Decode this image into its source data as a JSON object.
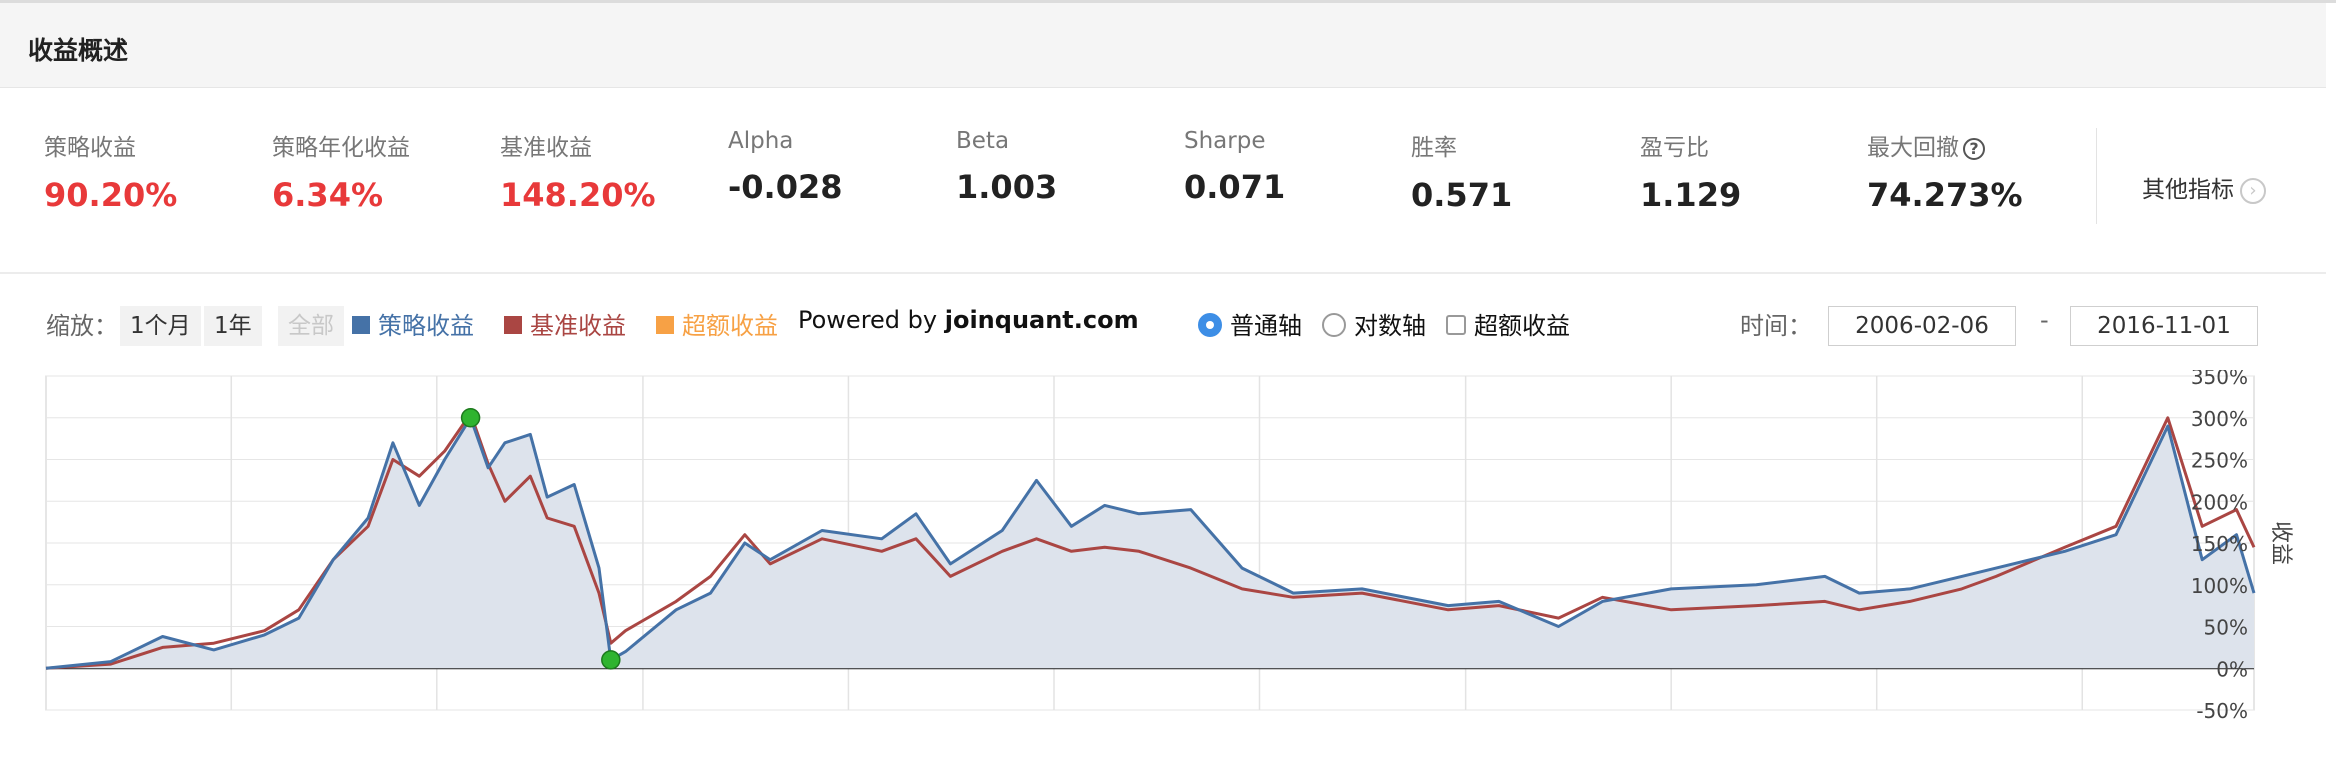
{
  "header": {
    "title": "收益概述"
  },
  "metrics": [
    {
      "label": "策略收益",
      "value": "90.20%",
      "color": "#e8393a"
    },
    {
      "label": "策略年化收益",
      "value": "6.34%",
      "color": "#e8393a"
    },
    {
      "label": "基准收益",
      "value": "148.20%",
      "color": "#e8393a"
    },
    {
      "label": "Alpha",
      "value": "-0.028",
      "color": "#222222"
    },
    {
      "label": "Beta",
      "value": "1.003",
      "color": "#222222"
    },
    {
      "label": "Sharpe",
      "value": "0.071",
      "color": "#222222"
    },
    {
      "label": "胜率",
      "value": "0.571",
      "color": "#222222"
    },
    {
      "label": "盈亏比",
      "value": "1.129",
      "color": "#222222"
    },
    {
      "label": "最大回撤",
      "value": "74.273%",
      "color": "#222222",
      "help_icon": "?"
    }
  ],
  "other_metrics": {
    "label": "其他指标",
    "icon": "chevron-right-icon",
    "glyph": "›"
  },
  "controls": {
    "zoom_label": "缩放：",
    "zoom_buttons": [
      "1个月",
      "1年",
      "全部"
    ],
    "legend": [
      {
        "label": "策略收益",
        "color": "#4572a7"
      },
      {
        "label": "基准收益",
        "color": "#aa4643"
      },
      {
        "label": "超额收益",
        "color": "#f7a145"
      }
    ],
    "powered_prefix": "Powered by ",
    "powered_site": "joinquant.com",
    "axis_options": [
      "普通轴",
      "对数轴"
    ],
    "axis_selected": "普通轴",
    "excess_checkbox": "超额收益",
    "time_label": "时间：",
    "date_start": "2006-02-06",
    "date_sep": "-",
    "date_end": "2016-11-01"
  },
  "chart_data": {
    "type": "line",
    "ylabel": "收益",
    "ylim": [
      -50,
      350
    ],
    "yticks": [
      "350%",
      "300%",
      "250%",
      "200%",
      "150%",
      "100%",
      "50%",
      "0%",
      "-50%"
    ],
    "xlim": [
      "2006-02-06",
      "2016-11-01"
    ],
    "series": [
      {
        "name": "策略收益",
        "color": "#4572a7",
        "points": [
          [
            "2006-02-06",
            0
          ],
          [
            "2006-06-01",
            8
          ],
          [
            "2006-09-01",
            38
          ],
          [
            "2006-12-01",
            22
          ],
          [
            "2007-03-01",
            40
          ],
          [
            "2007-05-01",
            60
          ],
          [
            "2007-07-01",
            130
          ],
          [
            "2007-09-01",
            180
          ],
          [
            "2007-10-15",
            270
          ],
          [
            "2007-12-01",
            195
          ],
          [
            "2008-01-15",
            250
          ],
          [
            "2008-03-01",
            300
          ],
          [
            "2008-04-01",
            240
          ],
          [
            "2008-05-01",
            270
          ],
          [
            "2008-06-15",
            280
          ],
          [
            "2008-07-15",
            205
          ],
          [
            "2008-09-01",
            220
          ],
          [
            "2008-10-15",
            120
          ],
          [
            "2008-11-05",
            10
          ],
          [
            "2008-12-01",
            20
          ],
          [
            "2009-03-01",
            70
          ],
          [
            "2009-05-01",
            90
          ],
          [
            "2009-07-01",
            150
          ],
          [
            "2009-08-15",
            130
          ],
          [
            "2009-11-15",
            165
          ],
          [
            "2010-03-01",
            155
          ],
          [
            "2010-05-01",
            185
          ],
          [
            "2010-07-01",
            125
          ],
          [
            "2010-10-01",
            165
          ],
          [
            "2010-12-01",
            225
          ],
          [
            "2011-02-01",
            170
          ],
          [
            "2011-04-01",
            195
          ],
          [
            "2011-06-01",
            185
          ],
          [
            "2011-09-01",
            190
          ],
          [
            "2011-12-01",
            120
          ],
          [
            "2012-03-01",
            90
          ],
          [
            "2012-07-01",
            95
          ],
          [
            "2012-12-01",
            75
          ],
          [
            "2013-03-01",
            80
          ],
          [
            "2013-06-15",
            50
          ],
          [
            "2013-09-01",
            80
          ],
          [
            "2014-01-01",
            95
          ],
          [
            "2014-06-01",
            100
          ],
          [
            "2014-10-01",
            110
          ],
          [
            "2014-12-01",
            90
          ],
          [
            "2015-03-01",
            95
          ],
          [
            "2015-06-01",
            110
          ],
          [
            "2015-08-01",
            120
          ],
          [
            "2015-12-01",
            140
          ],
          [
            "2016-03-01",
            160
          ],
          [
            "2016-06-01",
            290
          ],
          [
            "2016-08-01",
            130
          ],
          [
            "2016-10-01",
            160
          ],
          [
            "2016-11-01",
            90
          ]
        ]
      },
      {
        "name": "基准收益",
        "color": "#aa4643",
        "points": [
          [
            "2006-02-06",
            0
          ],
          [
            "2006-06-01",
            5
          ],
          [
            "2006-09-01",
            25
          ],
          [
            "2006-12-01",
            30
          ],
          [
            "2007-03-01",
            45
          ],
          [
            "2007-05-01",
            70
          ],
          [
            "2007-07-01",
            130
          ],
          [
            "2007-09-01",
            170
          ],
          [
            "2007-10-15",
            250
          ],
          [
            "2007-12-01",
            230
          ],
          [
            "2008-01-15",
            260
          ],
          [
            "2008-03-01",
            305
          ],
          [
            "2008-04-01",
            245
          ],
          [
            "2008-05-01",
            200
          ],
          [
            "2008-06-15",
            230
          ],
          [
            "2008-07-15",
            180
          ],
          [
            "2008-09-01",
            170
          ],
          [
            "2008-10-15",
            90
          ],
          [
            "2008-11-05",
            30
          ],
          [
            "2008-12-01",
            45
          ],
          [
            "2009-03-01",
            80
          ],
          [
            "2009-05-01",
            110
          ],
          [
            "2009-07-01",
            160
          ],
          [
            "2009-08-15",
            125
          ],
          [
            "2009-11-15",
            155
          ],
          [
            "2010-03-01",
            140
          ],
          [
            "2010-05-01",
            155
          ],
          [
            "2010-07-01",
            110
          ],
          [
            "2010-10-01",
            140
          ],
          [
            "2010-12-01",
            155
          ],
          [
            "2011-02-01",
            140
          ],
          [
            "2011-04-01",
            145
          ],
          [
            "2011-06-01",
            140
          ],
          [
            "2011-09-01",
            120
          ],
          [
            "2011-12-01",
            95
          ],
          [
            "2012-03-01",
            85
          ],
          [
            "2012-07-01",
            90
          ],
          [
            "2012-12-01",
            70
          ],
          [
            "2013-03-01",
            75
          ],
          [
            "2013-06-15",
            60
          ],
          [
            "2013-09-01",
            85
          ],
          [
            "2014-01-01",
            70
          ],
          [
            "2014-06-01",
            75
          ],
          [
            "2014-10-01",
            80
          ],
          [
            "2014-12-01",
            70
          ],
          [
            "2015-03-01",
            80
          ],
          [
            "2015-06-01",
            95
          ],
          [
            "2015-08-01",
            110
          ],
          [
            "2015-12-01",
            145
          ],
          [
            "2016-03-01",
            170
          ],
          [
            "2016-06-01",
            300
          ],
          [
            "2016-08-01",
            170
          ],
          [
            "2016-10-01",
            190
          ],
          [
            "2016-11-01",
            145
          ]
        ]
      }
    ],
    "markers": [
      {
        "date": "2008-03-01",
        "value": 300,
        "color": "#2fb42f"
      },
      {
        "date": "2008-11-05",
        "value": 10,
        "color": "#2fb42f"
      }
    ],
    "grid": true,
    "fill_color": "#dde3ec"
  }
}
